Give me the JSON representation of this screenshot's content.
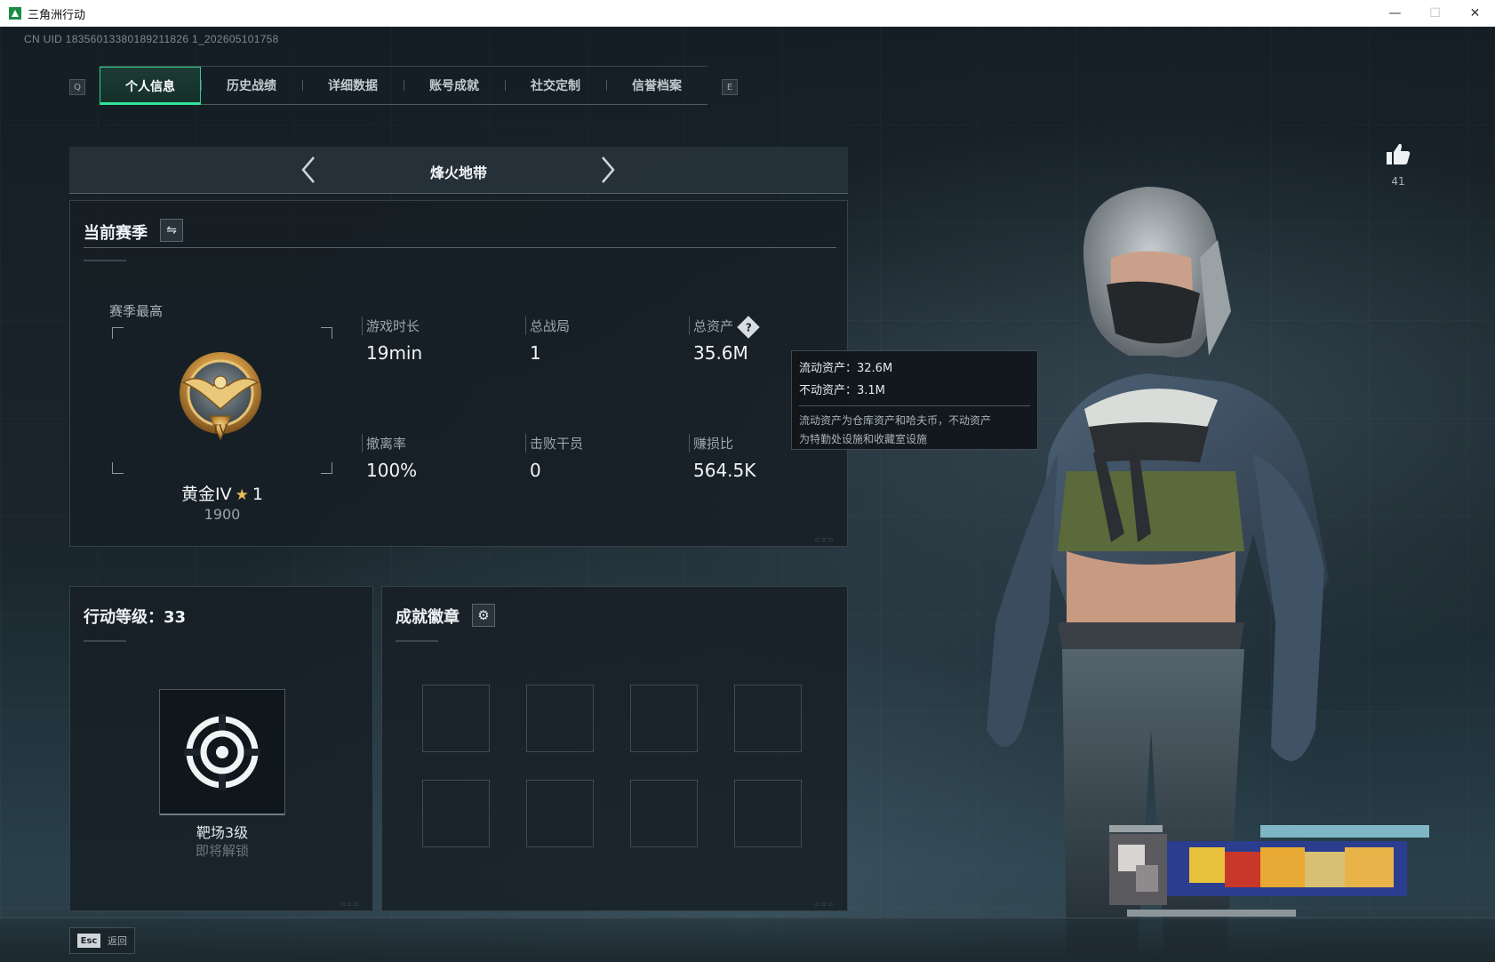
{
  "window": {
    "title": "三角洲行动",
    "controls": {
      "minimize": "—",
      "maximize": "☐",
      "close": "✕"
    }
  },
  "uid": "CN UID 18356013380189211826 1_202605101758",
  "tabs": {
    "left_key": "Q",
    "right_key": "E",
    "items": [
      {
        "label": "个人信息",
        "active": true
      },
      {
        "label": "历史战绩",
        "active": false
      },
      {
        "label": "详细数据",
        "active": false
      },
      {
        "label": "账号成就",
        "active": false
      },
      {
        "label": "社交定制",
        "active": false
      },
      {
        "label": "信誉档案",
        "active": false
      }
    ]
  },
  "mode_selector": {
    "prev_icon": "chevron-left-icon",
    "next_icon": "chevron-right-icon",
    "title": "烽火地带"
  },
  "season": {
    "title": "当前赛季",
    "swap_icon": "swap-icon",
    "best_label": "赛季最高",
    "rank_name": "黄金IV",
    "rank_stars": "1",
    "rank_score": "1900",
    "stats": {
      "playtime": {
        "label": "游戏时长",
        "value": "19min"
      },
      "total_matches": {
        "label": "总战局",
        "value": "1"
      },
      "total_assets": {
        "label": "总资产",
        "value": "35.6M"
      },
      "extract_rate": {
        "label": "撤离率",
        "value": "100%"
      },
      "kills": {
        "label": "击败干员",
        "value": "0"
      },
      "profit_ratio": {
        "label": "赚损比",
        "value": "564.5K"
      }
    }
  },
  "tooltip": {
    "liquid": "流动资产：32.6M",
    "fixed": "不动资产：3.1M",
    "note_line1": "流动资产为仓库资产和哈夫币，不动资产",
    "note_line2": "为特勤处设施和收藏室设施"
  },
  "level": {
    "title": "行动等级：33",
    "icon": "target-icon",
    "label": "靶场3级",
    "sub": "即将解锁"
  },
  "badges": {
    "title": "成就徽章",
    "settings_icon": "gear-icon",
    "slot_count": 8
  },
  "likes": {
    "icon": "thumbs-up-icon",
    "count": "41"
  },
  "footer": {
    "key": "Esc",
    "label": "返回"
  },
  "colors": {
    "accent": "#33e29c",
    "gold": "#e6bf55",
    "panel": "#161f25"
  }
}
